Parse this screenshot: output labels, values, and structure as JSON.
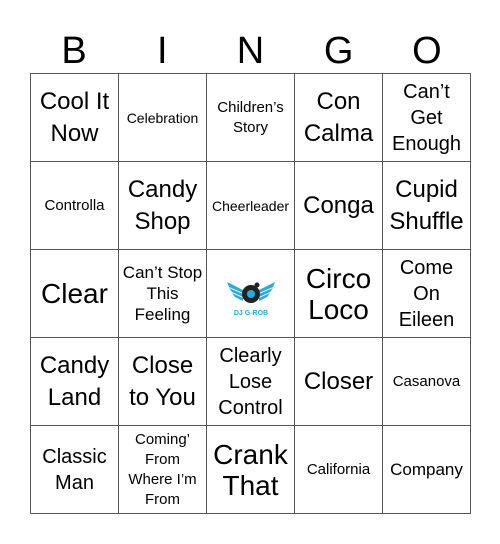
{
  "header": [
    "B",
    "I",
    "N",
    "G",
    "O"
  ],
  "cells": [
    {
      "text": "Cool It Now",
      "size": "s24"
    },
    {
      "text": "Celebration",
      "size": "s14"
    },
    {
      "text": "Children’s Story",
      "size": "s15"
    },
    {
      "text": "Con Calma",
      "size": "s24"
    },
    {
      "text": "Can’t Get Enough",
      "size": "s20"
    },
    {
      "text": "Controlla",
      "size": "s15"
    },
    {
      "text": "Candy Shop",
      "size": "s24"
    },
    {
      "text": "Cheerleader",
      "size": "s14"
    },
    {
      "text": "Conga",
      "size": "s24"
    },
    {
      "text": "Cupid Shuffle",
      "size": "s24"
    },
    {
      "text": "Clear",
      "size": "s28"
    },
    {
      "text": "Can’t Stop This Feeling",
      "size": "s17"
    },
    {
      "text": "",
      "free": true,
      "logo_text": "DJ G-ROB",
      "logo_color": "#29a9e0"
    },
    {
      "text": "Circo Loco",
      "size": "s28"
    },
    {
      "text": "Come On Eileen",
      "size": "s20"
    },
    {
      "text": "Candy Land",
      "size": "s24"
    },
    {
      "text": "Close to You",
      "size": "s24"
    },
    {
      "text": "Clearly Lose Control",
      "size": "s20"
    },
    {
      "text": "Closer",
      "size": "s24"
    },
    {
      "text": "Casanova",
      "size": "s15"
    },
    {
      "text": "Classic Man",
      "size": "s20"
    },
    {
      "text": "Coming’ From Where I’m From",
      "size": "s15"
    },
    {
      "text": "Crank That",
      "size": "s28"
    },
    {
      "text": "California",
      "size": "s15"
    },
    {
      "text": "Company",
      "size": "s17"
    }
  ]
}
